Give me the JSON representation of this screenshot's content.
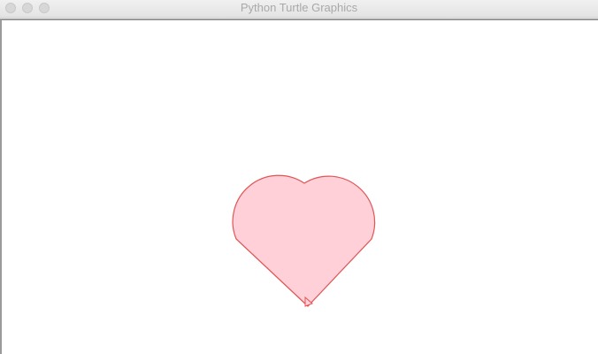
{
  "window": {
    "title": "Python Turtle Graphics",
    "controls": [
      "close-button",
      "minimize-button",
      "zoom-button"
    ]
  },
  "canvas": {
    "background": "#ffffff",
    "drawing": {
      "shape": "heart",
      "fill_color": "#ffd0d8",
      "pen_color": "#e05555",
      "turtle_cursor": "arrow"
    }
  }
}
